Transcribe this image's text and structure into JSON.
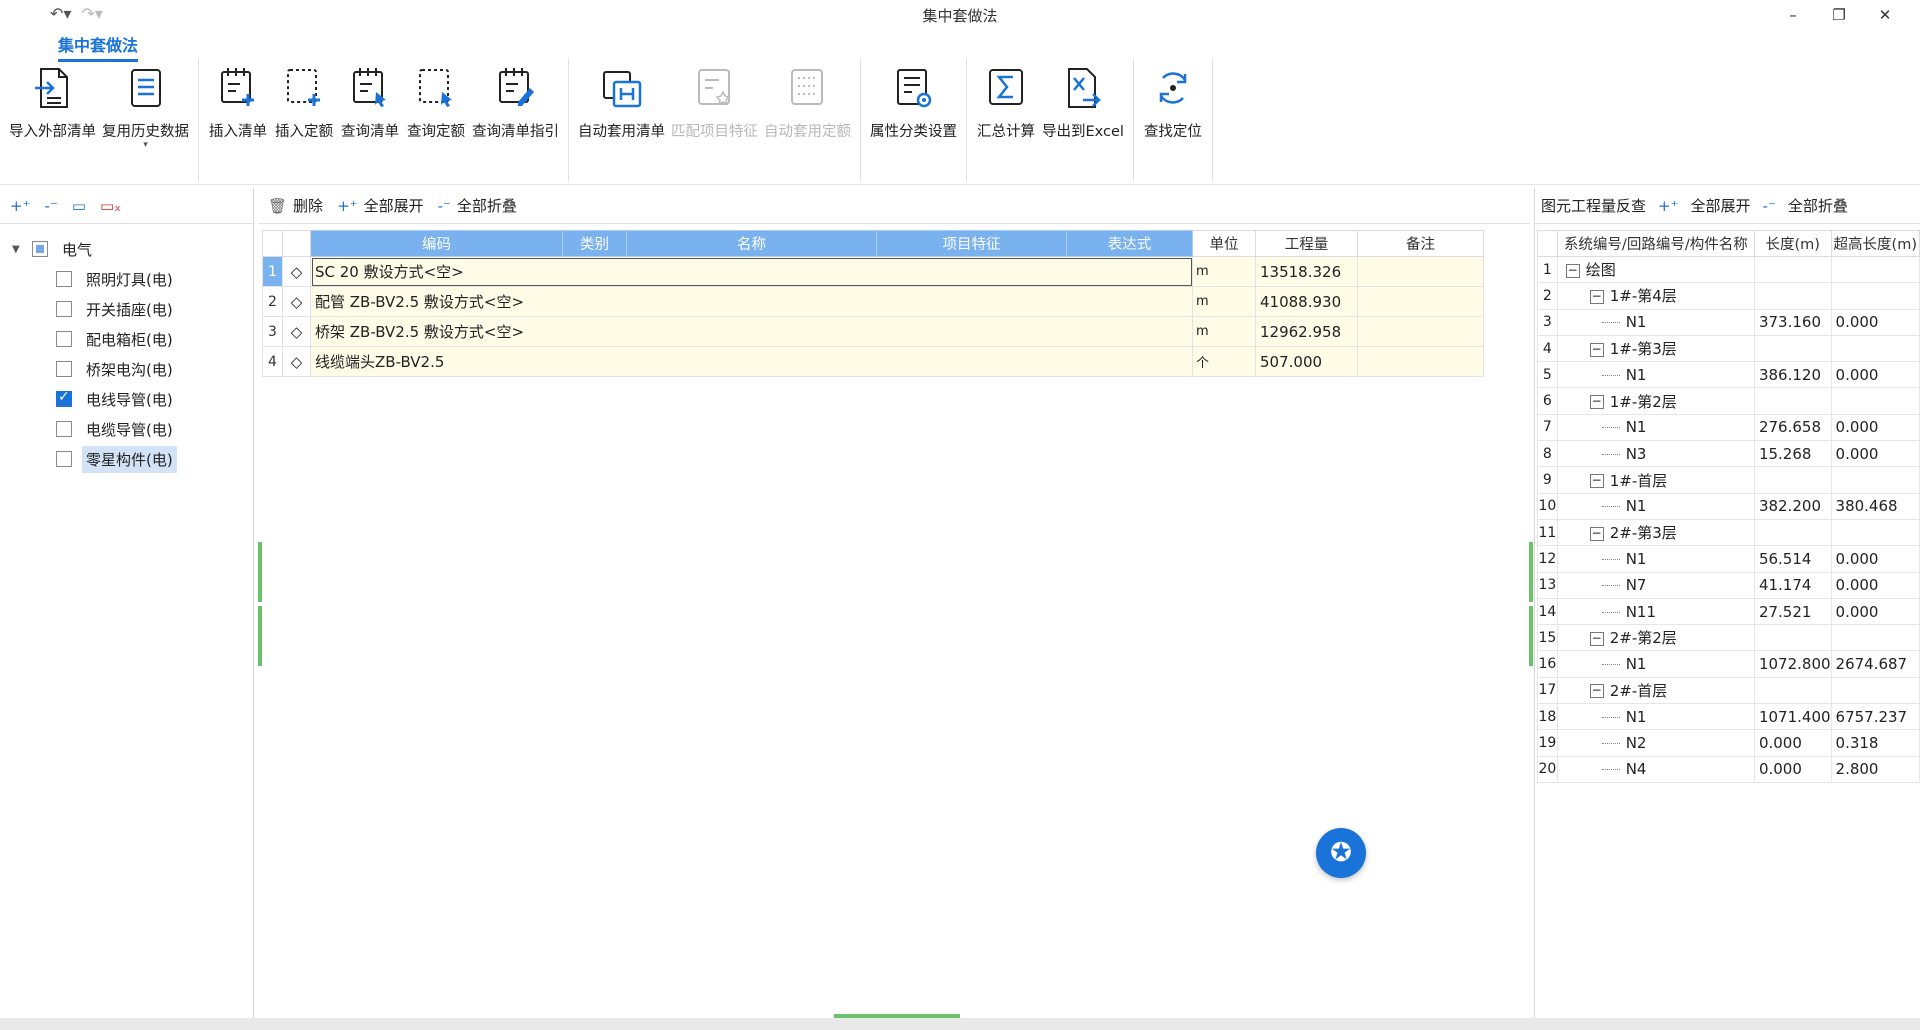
{
  "window": {
    "title": "集中套做法"
  },
  "ribbon": {
    "tab": "集中套做法",
    "groups": [
      [
        {
          "label": "导入外部清单",
          "icon": "import-list-icon"
        },
        {
          "label": "复用历史数据",
          "icon": "history-data-icon"
        }
      ],
      [
        {
          "label": "插入清单",
          "icon": "insert-list-icon"
        },
        {
          "label": "插入定额",
          "icon": "insert-quota-icon"
        },
        {
          "label": "查询清单",
          "icon": "query-list-icon"
        },
        {
          "label": "查询定额",
          "icon": "query-quota-icon"
        },
        {
          "label": "查询清单指引",
          "icon": "query-guide-icon"
        }
      ],
      [
        {
          "label": "自动套用清单",
          "icon": "auto-apply-list-icon"
        },
        {
          "label": "匹配项目特征",
          "icon": "match-feature-icon"
        },
        {
          "label": "自动套用定额",
          "icon": "auto-apply-quota-icon"
        }
      ],
      [
        {
          "label": "属性分类设置",
          "icon": "attribute-settings-icon"
        }
      ],
      [
        {
          "label": "汇总计算",
          "icon": "sum-icon"
        },
        {
          "label": "导出到Excel",
          "icon": "excel-export-icon"
        }
      ],
      [
        {
          "label": "查找定位",
          "icon": "locate-icon"
        }
      ]
    ]
  },
  "tree": {
    "root": "电气",
    "items": [
      {
        "label": "照明灯具(电)",
        "checked": false
      },
      {
        "label": "开关插座(电)",
        "checked": false
      },
      {
        "label": "配电箱柜(电)",
        "checked": false
      },
      {
        "label": "桥架电沟(电)",
        "checked": false
      },
      {
        "label": "电线导管(电)",
        "checked": true
      },
      {
        "label": "电缆导管(电)",
        "checked": false
      },
      {
        "label": "零星构件(电)",
        "checked": false
      }
    ]
  },
  "center_toolbar": {
    "delete": "删除",
    "expand_all": "全部展开",
    "collapse_all": "全部折叠"
  },
  "grid": {
    "headers": [
      "编码",
      "类别",
      "名称",
      "项目特征",
      "表达式",
      "单位",
      "工程量",
      "备注"
    ],
    "rows": [
      {
        "no": "1",
        "code": "SC 20 敷设方式<空>",
        "unit": "m",
        "qty": "13518.326"
      },
      {
        "no": "2",
        "code": "配管 ZB-BV2.5 敷设方式<空>",
        "unit": "m",
        "qty": "41088.930"
      },
      {
        "no": "3",
        "code": "桥架 ZB-BV2.5 敷设方式<空>",
        "unit": "m",
        "qty": "12962.958"
      },
      {
        "no": "4",
        "code": "线缆端头ZB-BV2.5",
        "unit": "个",
        "qty": "507.000"
      }
    ]
  },
  "right_toolbar": {
    "title": "图元工程量反查",
    "expand_all": "全部展开",
    "collapse_all": "全部折叠"
  },
  "rgrid": {
    "headers": [
      "系统编号/回路编号/构件名称",
      "长度(m)",
      "超高长度(m)"
    ],
    "rows": [
      {
        "no": "1",
        "name": "绘图",
        "type": "root",
        "len": "",
        "over": ""
      },
      {
        "no": "2",
        "name": "1#-第4层",
        "type": "group",
        "len": "",
        "over": ""
      },
      {
        "no": "3",
        "name": "N1",
        "type": "leaf",
        "len": "373.160",
        "over": "0.000"
      },
      {
        "no": "4",
        "name": "1#-第3层",
        "type": "group",
        "len": "",
        "over": ""
      },
      {
        "no": "5",
        "name": "N1",
        "type": "leaf",
        "len": "386.120",
        "over": "0.000"
      },
      {
        "no": "6",
        "name": "1#-第2层",
        "type": "group",
        "len": "",
        "over": ""
      },
      {
        "no": "7",
        "name": "N1",
        "type": "leaf",
        "len": "276.658",
        "over": "0.000"
      },
      {
        "no": "8",
        "name": "N3",
        "type": "leaf",
        "len": "15.268",
        "over": "0.000"
      },
      {
        "no": "9",
        "name": "1#-首层",
        "type": "group",
        "len": "",
        "over": ""
      },
      {
        "no": "10",
        "name": "N1",
        "type": "leaf",
        "len": "382.200",
        "over": "380.468"
      },
      {
        "no": "11",
        "name": "2#-第3层",
        "type": "group",
        "len": "",
        "over": ""
      },
      {
        "no": "12",
        "name": "N1",
        "type": "leaf",
        "len": "56.514",
        "over": "0.000"
      },
      {
        "no": "13",
        "name": "N7",
        "type": "leaf",
        "len": "41.174",
        "over": "0.000"
      },
      {
        "no": "14",
        "name": "N11",
        "type": "leaf",
        "len": "27.521",
        "over": "0.000"
      },
      {
        "no": "15",
        "name": "2#-第2层",
        "type": "group",
        "len": "",
        "over": ""
      },
      {
        "no": "16",
        "name": "N1",
        "type": "leaf",
        "len": "1072.800",
        "over": "2674.687"
      },
      {
        "no": "17",
        "name": "2#-首层",
        "type": "group",
        "len": "",
        "over": ""
      },
      {
        "no": "18",
        "name": "N1",
        "type": "leaf",
        "len": "1071.400",
        "over": "6757.237"
      },
      {
        "no": "19",
        "name": "N2",
        "type": "leaf",
        "len": "0.000",
        "over": "0.318"
      },
      {
        "no": "20",
        "name": "N4",
        "type": "leaf",
        "len": "0.000",
        "over": "2.800"
      }
    ]
  },
  "colors": {
    "accent": "#1a73d9",
    "header_blue": "#79b2ee",
    "row_fill": "#fefbe7",
    "marker_green": "#6ac36a"
  }
}
